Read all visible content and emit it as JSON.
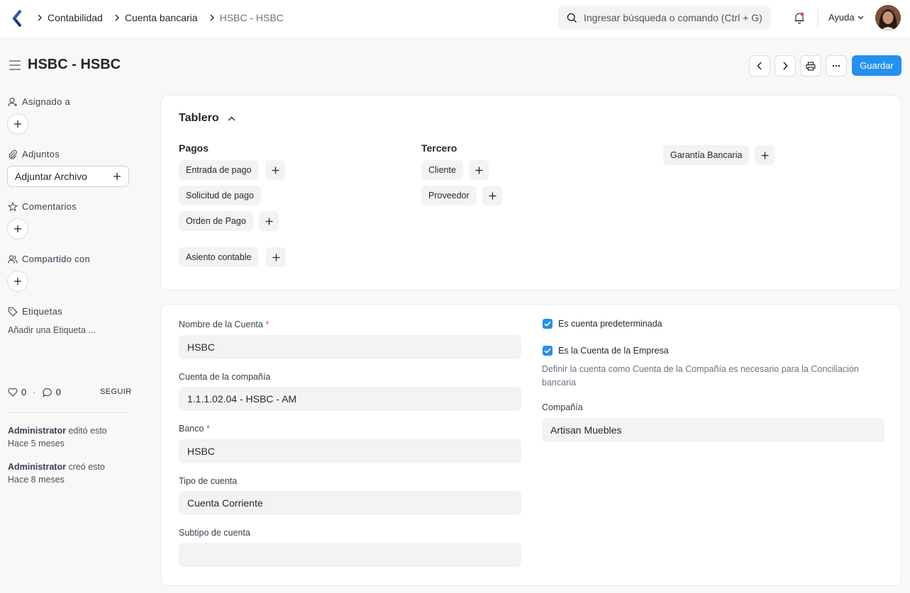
{
  "navbar": {
    "breadcrumbs": [
      "Contabilidad",
      "Cuenta bancaria",
      "HSBC - HSBC"
    ],
    "search_placeholder": "Ingresar búsqueda o comando (Ctrl + G)",
    "help_label": "Ayuda"
  },
  "page": {
    "title": "HSBC - HSBC",
    "save_label": "Guardar"
  },
  "sidebar": {
    "assigned_label": "Asignado a",
    "attachments_label": "Adjuntos",
    "attach_button": "Adjuntar Archivo",
    "comments_label": "Comentarios",
    "shared_label": "Compartido con",
    "tags_label": "Etiquetas",
    "add_tag": "Añadir una Etiqueta ...",
    "likes": "0",
    "comments_count": "0",
    "separator": "·",
    "follow": "SEGUIR",
    "activity": [
      {
        "user": "Administrator",
        "action": "editó esto",
        "time": "Hace 5 meses"
      },
      {
        "user": "Administrator",
        "action": "creó esto",
        "time": "Hace 8 meses"
      }
    ]
  },
  "dashboard": {
    "title": "Tablero",
    "groups": [
      {
        "title": "Pagos",
        "items": [
          "Entrada de pago",
          "Solicitud de pago",
          "Orden de Pago",
          "Asiento contable"
        ]
      },
      {
        "title": "Tercero",
        "items": [
          "Cliente",
          "Proveedor"
        ]
      },
      {
        "title": "",
        "items": [
          "Garantía Bancaria"
        ]
      }
    ]
  },
  "form": {
    "account_name": {
      "label": "Nombre de la Cuenta",
      "value": "HSBC",
      "required": true
    },
    "company_account": {
      "label": "Cuenta de la compañía",
      "value": "1.1.1.02.04 - HSBC - AM"
    },
    "bank": {
      "label": "Banco",
      "value": "HSBC",
      "required": true
    },
    "account_type": {
      "label": "Tipo de cuenta",
      "value": "Cuenta Corriente"
    },
    "account_subtype": {
      "label": "Subtipo de cuenta",
      "value": ""
    },
    "is_default": {
      "label": "Es cuenta predeterminada",
      "checked": true
    },
    "is_company_account": {
      "label": "Es la Cuenta de la Empresa",
      "checked": true
    },
    "company_account_help": "Definir la cuenta como Cuenta de la Compañía es necesario para la Conciliación bancaria",
    "company": {
      "label": "Compañía",
      "value": "Artisan Muebles"
    },
    "required_mark": "*"
  },
  "colors": {
    "accent": "#2490ef",
    "required": "#e24c4c"
  }
}
